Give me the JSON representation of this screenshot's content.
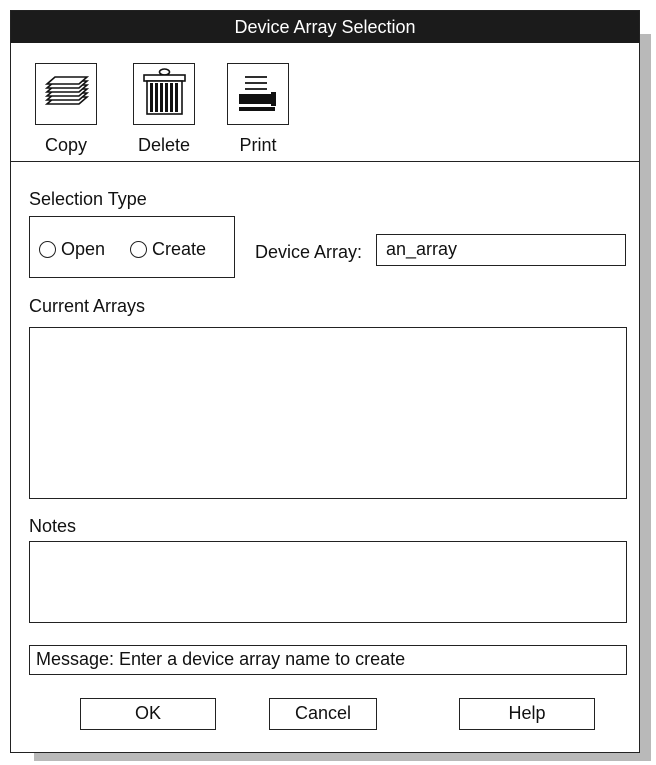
{
  "window": {
    "title": "Device Array Selection"
  },
  "toolbar": {
    "copy_label": "Copy",
    "delete_label": "Delete",
    "print_label": "Print"
  },
  "selection": {
    "section_label": "Selection Type",
    "open_label": "Open",
    "create_label": "Create"
  },
  "device_array": {
    "label": "Device Array:",
    "value": "an_array"
  },
  "current_arrays": {
    "label": "Current Arrays",
    "items": []
  },
  "notes": {
    "label": "Notes",
    "value": ""
  },
  "message": {
    "text": "Message: Enter a device array name to create"
  },
  "buttons": {
    "ok": "OK",
    "cancel": "Cancel",
    "help": "Help"
  }
}
